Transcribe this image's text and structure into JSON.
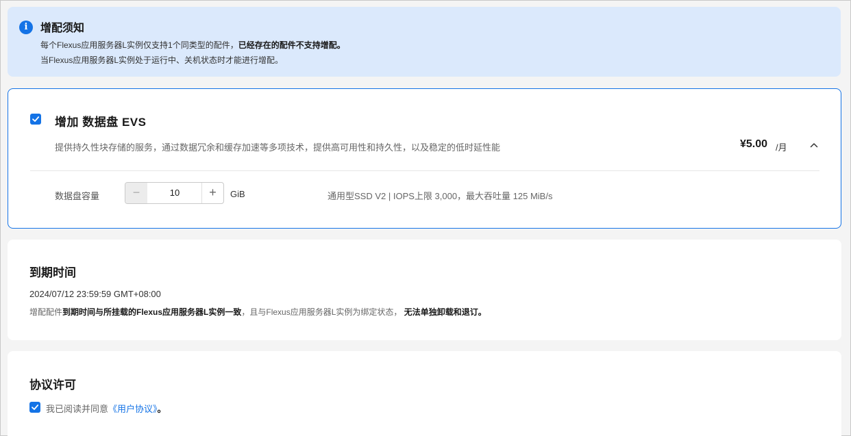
{
  "notice": {
    "title": "增配须知",
    "line1_text": "每个Flexus应用服务器L实例仅支持1个同类型的配件，",
    "line1_bold": "已经存在的配件不支持增配。",
    "line2": "当Flexus应用服务器L实例处于运行中、关机状态时才能进行增配。"
  },
  "evs": {
    "title": "增加 数据盘 EVS",
    "description": "提供持久性块存储的服务，通过数据冗余和缓存加速等多项技术，提供高可用性和持久性，以及稳定的低时延性能",
    "price": "¥5.00",
    "price_unit": "/月",
    "checked": true,
    "capacity_label": "数据盘容量",
    "capacity_value": "10",
    "capacity_unit": "GiB",
    "spec": "通用型SSD V2 | IOPS上限 3,000，最大吞吐量 125 MiB/s"
  },
  "expiry": {
    "title": "到期时间",
    "date": "2024/07/12 23:59:59 GMT+08:00",
    "note_prefix": "增配配件",
    "note_bold1": "到期时间与所挂载的Flexus应用服务器L实例一致",
    "note_middle": "，且与Flexus应用服务器L实例为绑定状态，",
    "note_bold2": "无法单独卸载和退订。"
  },
  "agreement": {
    "title": "协议许可",
    "text": "我已阅读并同意",
    "link": "《用户协议》",
    "end": "。",
    "checked": true
  },
  "colors": {
    "accent": "#1473e6",
    "notice_bg": "#dbe9fc"
  }
}
